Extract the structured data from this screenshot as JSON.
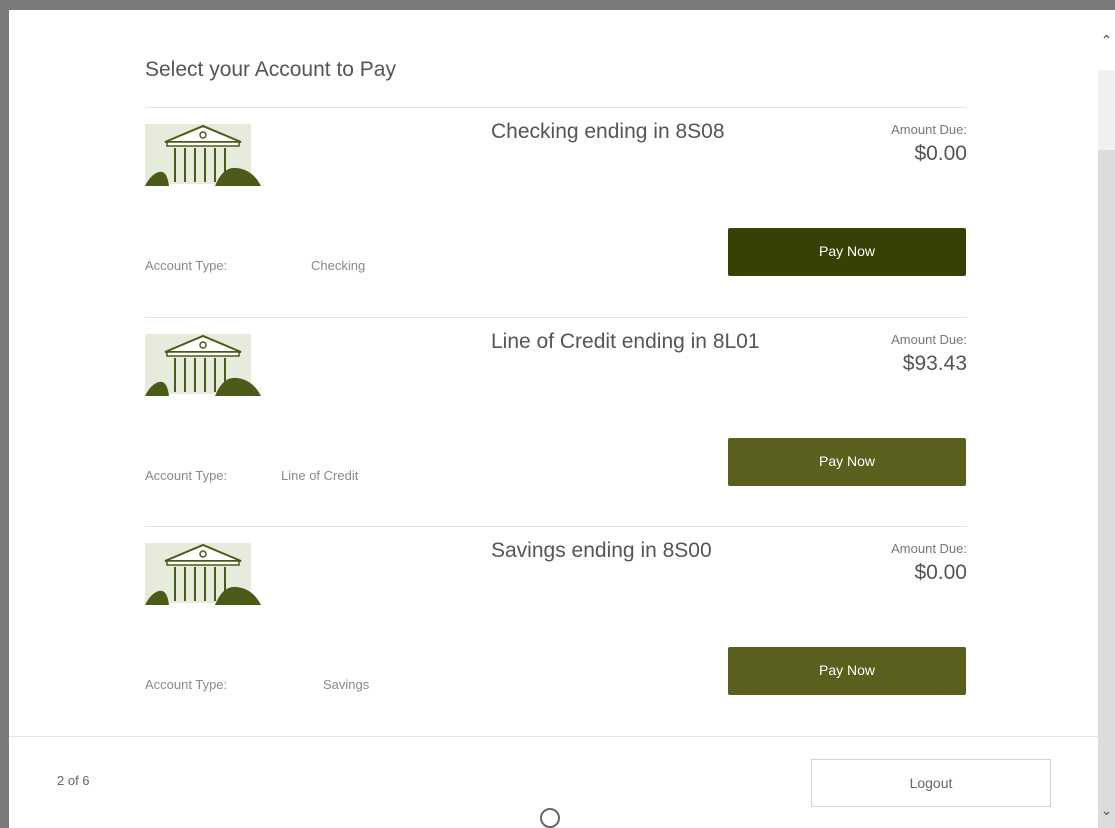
{
  "heading": "Select your Account to Pay",
  "accounts": [
    {
      "name": "Checking ending in 8S08",
      "amount_due_label": "Amount Due:",
      "amount_due": "$0.00",
      "type_label": "Account Type:",
      "type_value": "Checking",
      "pay_label": "Pay Now"
    },
    {
      "name": "Line of Credit ending in 8L01",
      "amount_due_label": "Amount Due:",
      "amount_due": "$93.43",
      "type_label": "Account Type:",
      "type_value": "Line of Credit",
      "pay_label": "Pay Now"
    },
    {
      "name": "Savings ending in 8S00",
      "amount_due_label": "Amount Due:",
      "amount_due": "$0.00",
      "type_label": "Account Type:",
      "type_value": "Savings",
      "pay_label": "Pay Now"
    }
  ],
  "footer": {
    "page_indicator": "2 of 6",
    "logout_label": "Logout"
  },
  "icons": {
    "account": "bank-building-icon",
    "scroll_up": "chevron-up-icon",
    "scroll_down": "chevron-down-icon"
  },
  "colors": {
    "primary_button": "#394006",
    "secondary_button": "#5b5f1e",
    "icon_green": "#4b5a16",
    "icon_bg": "#e6ebdc"
  }
}
